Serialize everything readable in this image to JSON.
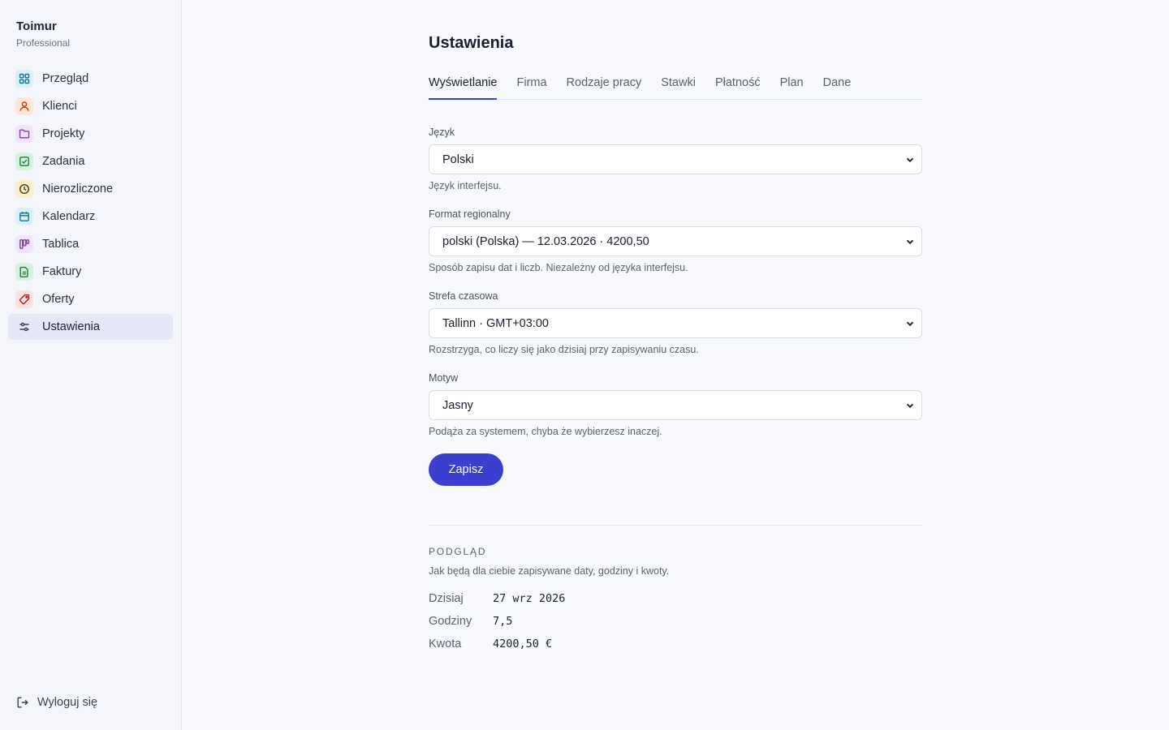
{
  "sidebar": {
    "brand_name": "Toimur",
    "brand_plan": "Professional",
    "items": [
      {
        "label": "Przegląd",
        "icon": "grid-icon",
        "color": "#0e7490",
        "bg": "#d9f1f5"
      },
      {
        "label": "Klienci",
        "icon": "user-icon",
        "color": "#c2410c",
        "bg": "#fde6d8"
      },
      {
        "label": "Projekty",
        "icon": "folder-icon",
        "color": "#7e3fa6",
        "bg": "#f1e3f8"
      },
      {
        "label": "Zadania",
        "icon": "check-square-icon",
        "color": "#15803d",
        "bg": "#d8f2e0"
      },
      {
        "label": "Nierozliczone",
        "icon": "clock-icon",
        "color": "#a16207",
        "bg": "#fbefc9"
      },
      {
        "label": "Kalendarz",
        "icon": "calendar-icon",
        "color": "#0e7490",
        "bg": "#d9f1f5"
      },
      {
        "label": "Tablica",
        "icon": "kanban-icon",
        "color": "#7e3fa6",
        "bg": "#f1e3f8"
      },
      {
        "label": "Faktury",
        "icon": "document-icon",
        "color": "#15803d",
        "bg": "#d8f2e0"
      },
      {
        "label": "Oferty",
        "icon": "tag-icon",
        "color": "#b91c1c",
        "bg": "#fde0e0"
      },
      {
        "label": "Ustawienia",
        "icon": "sliders-icon",
        "color": "#3a3f4e",
        "bg": "transparent"
      }
    ],
    "active_index": 9,
    "logout_label": "Wyloguj się"
  },
  "main": {
    "title": "Ustawienia",
    "tabs": [
      {
        "label": "Wyświetlanie",
        "active": true
      },
      {
        "label": "Firma"
      },
      {
        "label": "Rodzaje pracy"
      },
      {
        "label": "Stawki"
      },
      {
        "label": "Płatność"
      },
      {
        "label": "Plan"
      },
      {
        "label": "Dane"
      }
    ],
    "fields": [
      {
        "label": "Język",
        "value": "Polski",
        "hint": "Język interfejsu."
      },
      {
        "label": "Format regionalny",
        "value": "polski (Polska) — 12.03.2026 · 4200,50",
        "hint": "Sposób zapisu dat i liczb. Niezależny od języka interfejsu."
      },
      {
        "label": "Strefa czasowa",
        "value": "Tallinn · GMT+03:00",
        "hint": "Rozstrzyga, co liczy się jako dzisiaj przy zapisywaniu czasu."
      },
      {
        "label": "Motyw",
        "value": "Jasny",
        "hint": "Podąża za systemem, chyba że wybierzesz inaczej."
      }
    ],
    "save_label": "Zapisz",
    "preview": {
      "title": "PODGLĄD",
      "description": "Jak będą dla ciebie zapisywane daty, godziny i kwoty.",
      "rows": [
        {
          "key": "Dzisiaj",
          "value": "27 wrz 2026"
        },
        {
          "key": "Godziny",
          "value": "7,5"
        },
        {
          "key": "Kwota",
          "value": "4200,50 €"
        }
      ]
    }
  },
  "colors": {
    "accent": "#3b3fd0",
    "active_nav_bg": "#e4e8f7"
  }
}
